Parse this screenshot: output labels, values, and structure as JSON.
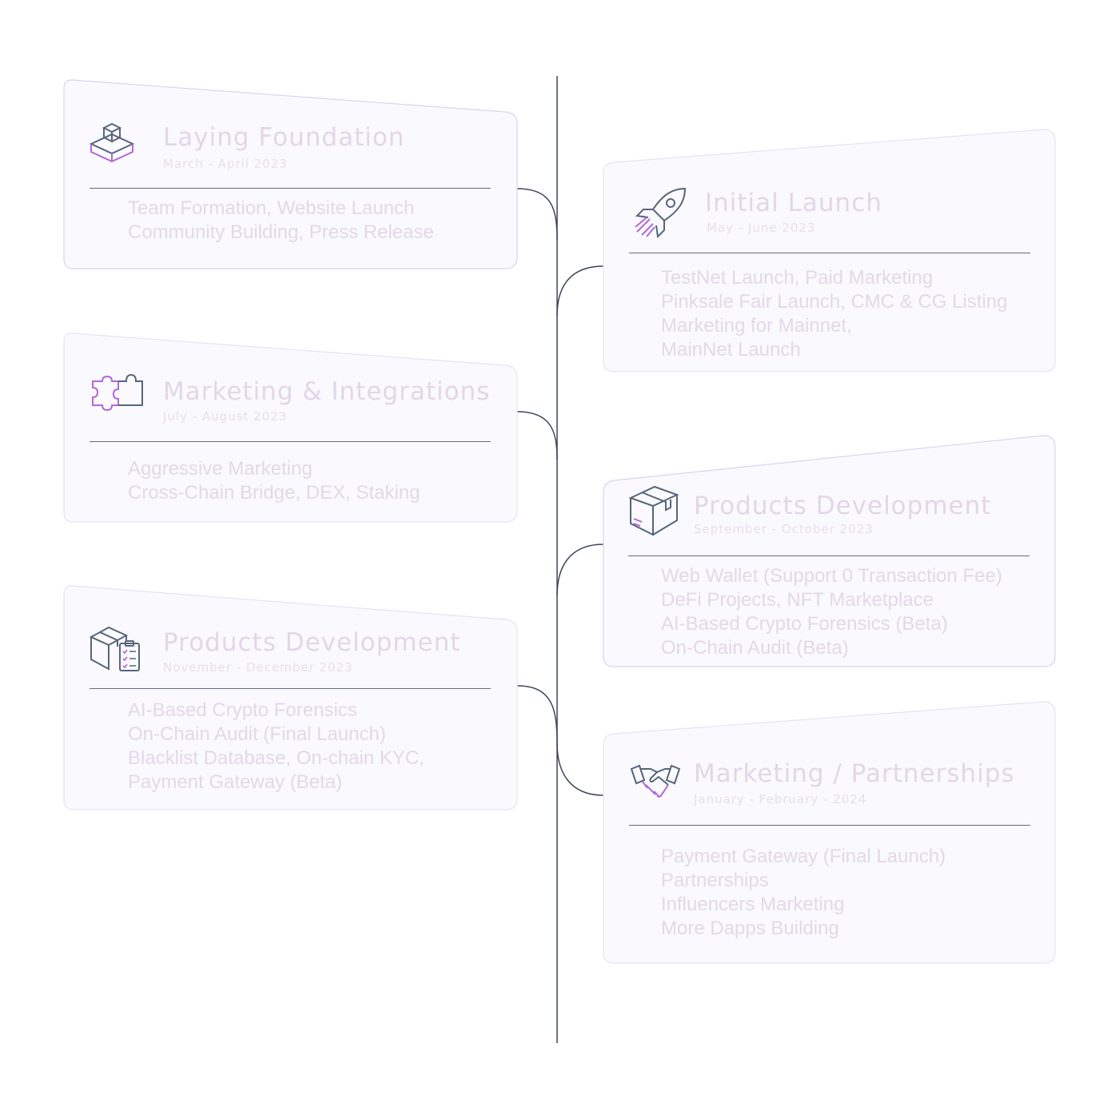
{
  "phases": [
    {
      "title": "Laying Foundation",
      "date": "March - April 2023",
      "icon": "building-blocks-icon",
      "items": [
        "Team Formation, Website Launch",
        "Community Building, Press Release"
      ]
    },
    {
      "title": "Initial Launch",
      "date": "May - June 2023",
      "icon": "rocket-icon",
      "items": [
        "TestNet Launch, Paid Marketing",
        "Pinksale Fair Launch, CMC & CG Listing",
        "Marketing for Mainnet,",
        "MainNet Launch"
      ]
    },
    {
      "title": "Marketing & Integrations",
      "date": "July - August 2023",
      "icon": "puzzle-icon",
      "items": [
        "Aggressive Marketing",
        "Cross-Chain Bridge, DEX, Staking"
      ]
    },
    {
      "title": "Products Development",
      "date": "September - October 2023",
      "icon": "package-icon",
      "items": [
        "Web Wallet (Support 0 Transaction Fee)",
        "DeFi Projects,  NFT Marketplace",
        "AI-Based Crypto Forensics (Beta)",
        "On-Chain Audit (Beta)"
      ]
    },
    {
      "title": "Products Development",
      "date": "November - December 2023",
      "icon": "package-checklist-icon",
      "items": [
        "AI-Based Crypto Forensics",
        "On-Chain Audit (Final Launch)",
        "Blacklist Database, On-chain KYC,",
        "Payment Gateway (Beta)"
      ]
    },
    {
      "title": "Marketing / Partnerships",
      "date": "January - February - 2024",
      "icon": "handshake-icon",
      "items": [
        "Payment Gateway (Final Launch)",
        "Partnerships",
        "Influencers Marketing",
        "More Dapps Building"
      ]
    }
  ],
  "colors": {
    "timeline_line": "#3d4658",
    "card_fill": "#faf9fe",
    "card_border": "#d8d4ee",
    "text": "#e3d8e8",
    "icon_dark": "#56657a",
    "icon_accent": "#b06ad8"
  }
}
